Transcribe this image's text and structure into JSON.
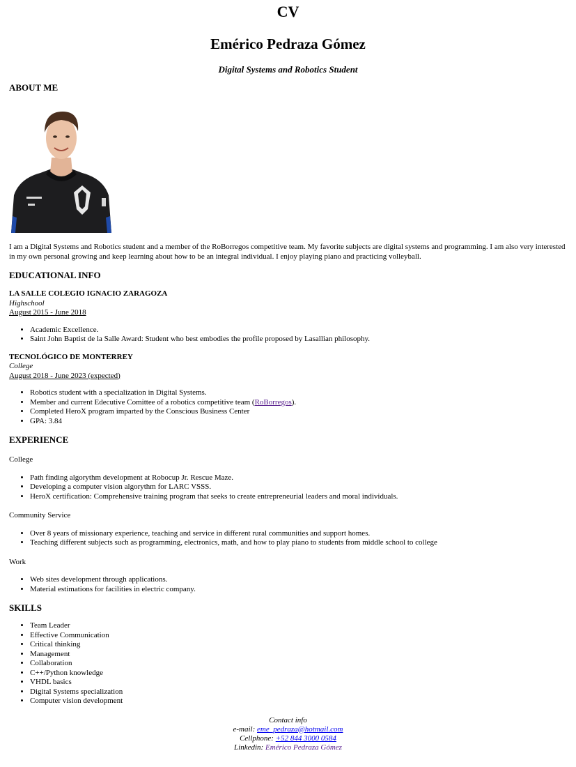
{
  "header": {
    "cv_title": "CV",
    "name": "Emérico Pedraza Gómez",
    "subtitle": "Digital Systems and Robotics Student"
  },
  "about": {
    "heading": "ABOUT ME",
    "photo_icon": "profile-photo",
    "text": "I am a Digital Systems and Robotics student and a member of the RoBorregos competitive team. My favorite subjects are digital systems and programming. I am also very interested in my own personal growing and keep learning about how to be an integral individual. I enjoy playing piano and practicing volleyball."
  },
  "education": {
    "heading": "EDUCATIONAL INFO",
    "schools": [
      {
        "name": "LA SALLE COLEGIO IGNACIO ZARAGOZA",
        "level": "Highschool",
        "dates": "August 2015 - June 2018",
        "items": [
          "Academic Excellence.",
          "Saint John Baptist de la Salle Award: Student who best embodies the profile proposed by Lasallian philosophy."
        ]
      },
      {
        "name": "TECNOLÓGICO DE MONTERREY",
        "level": "College",
        "dates": "August 2018 - June 2023 (expected)",
        "items": [
          "Robotics student with a specialization in Digital Systems.",
          "Member and current Edecutive Comittee of a robotics competitive team (",
          "Completed HeroX program imparted by the Conscious Business Center",
          "GPA: 3.84"
        ],
        "link_text": "RoBorregos",
        "link_suffix": ")."
      }
    ]
  },
  "experience": {
    "heading": "EXPERIENCE",
    "groups": [
      {
        "label": "College",
        "items": [
          "Path finding algorythm development at Robocup Jr. Rescue Maze.",
          "Developing a computer vision algorythm for LARC VSSS.",
          "HeroX certification: Comprehensive training program that seeks to create entrepreneurial leaders and moral individuals."
        ]
      },
      {
        "label": "Community Service",
        "items": [
          "Over 8 years of missionary experience, teaching and service in different rural communities and support homes.",
          "Teaching different subjects such as programming, electronics, math, and how to play piano to students from middle school to college"
        ]
      },
      {
        "label": "Work",
        "items": [
          "Web sites development through applications.",
          "Material estimations for facilities in electric company."
        ]
      }
    ]
  },
  "skills": {
    "heading": "SKILLS",
    "items": [
      "Team Leader",
      "Effective Communication",
      "Critical thinking",
      "Management",
      "Collaboration",
      "C++/Python knowledge",
      "VHDL basics",
      "Digital Systems specialization",
      "Computer vision development"
    ]
  },
  "contact": {
    "title": "Contact info",
    "email_label": "e-mail: ",
    "email": "eme_pedraza@hotmail.com",
    "phone_label": "Cellphone: ",
    "phone": "+52 844 3000 0584",
    "linkedin_label": "Linkedin: ",
    "linkedin": "Emérico Pedraza Gómez"
  }
}
